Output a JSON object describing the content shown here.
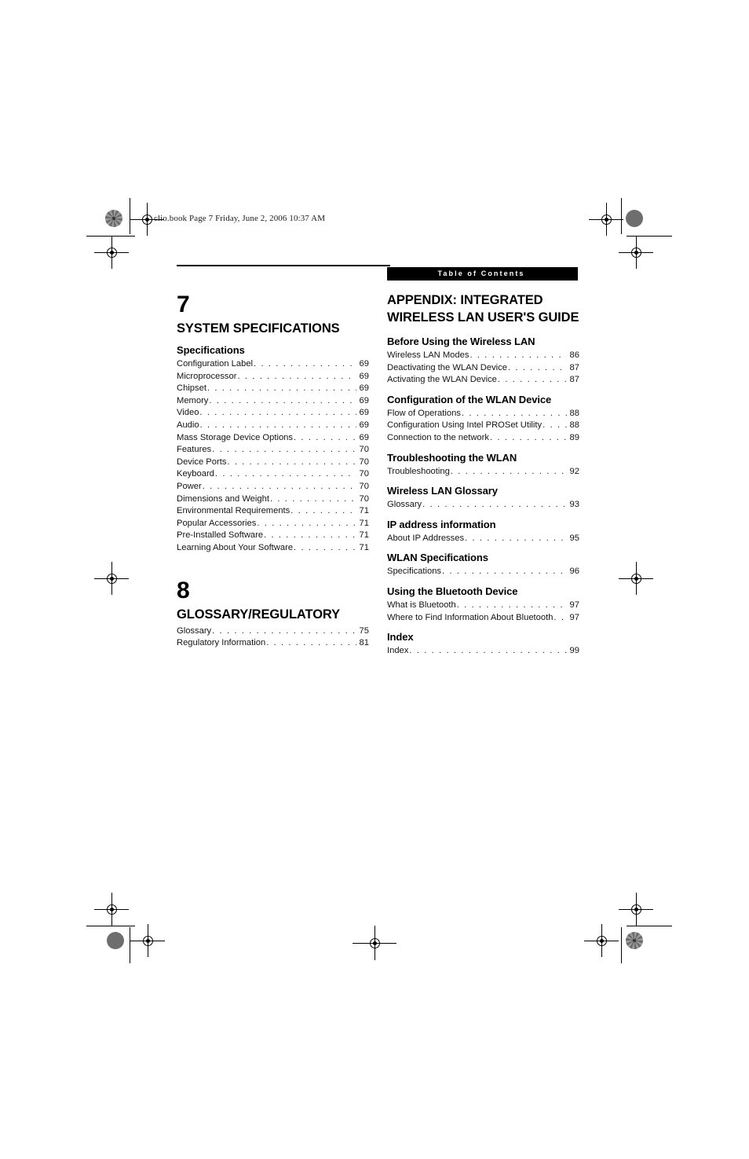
{
  "document_header": "clio.book  Page 7  Friday, June 2, 2006  10:37 AM",
  "banner": {
    "label": "Table of Contents"
  },
  "left_column": {
    "chapters": [
      {
        "number": "7",
        "title": "SYSTEM SPECIFICATIONS",
        "sections": [
          {
            "heading": "Specifications",
            "entries": [
              {
                "label": "Configuration Label",
                "page": "69"
              },
              {
                "label": "Microprocessor",
                "page": "69"
              },
              {
                "label": "Chipset",
                "page": "69"
              },
              {
                "label": "Memory",
                "page": "69"
              },
              {
                "label": "Video",
                "page": "69"
              },
              {
                "label": "Audio",
                "page": "69"
              },
              {
                "label": "Mass Storage Device Options",
                "page": "69"
              },
              {
                "label": "Features",
                "page": "70"
              },
              {
                "label": "Device Ports",
                "page": "70"
              },
              {
                "label": "Keyboard",
                "page": "70"
              },
              {
                "label": "Power",
                "page": "70"
              },
              {
                "label": "Dimensions and Weight",
                "page": "70"
              },
              {
                "label": "Environmental Requirements",
                "page": "71"
              },
              {
                "label": "Popular Accessories",
                "page": "71"
              },
              {
                "label": "Pre-Installed Software",
                "page": "71"
              },
              {
                "label": "Learning About Your Software",
                "page": "71"
              }
            ]
          }
        ]
      },
      {
        "number": "8",
        "title": "GLOSSARY/REGULATORY",
        "sections": [
          {
            "heading": "",
            "entries": [
              {
                "label": "Glossary",
                "page": "75"
              },
              {
                "label": "Regulatory Information",
                "page": "81"
              }
            ]
          }
        ]
      }
    ]
  },
  "right_column": {
    "title": "APPENDIX: INTEGRATED WIRELESS LAN USER'S GUIDE",
    "sections": [
      {
        "heading": "Before Using the Wireless LAN",
        "entries": [
          {
            "label": "Wireless LAN Modes",
            "page": "86"
          },
          {
            "label": "Deactivating the WLAN Device",
            "page": "87"
          },
          {
            "label": "Activating the WLAN Device",
            "page": "87"
          }
        ]
      },
      {
        "heading": "Configuration of the WLAN Device",
        "entries": [
          {
            "label": "Flow of Operations",
            "page": "88"
          },
          {
            "label": "Configuration Using Intel PROSet Utility",
            "page": "88"
          },
          {
            "label": "Connection to the network",
            "page": "89"
          }
        ]
      },
      {
        "heading": "Troubleshooting the WLAN",
        "entries": [
          {
            "label": "Troubleshooting",
            "page": "92"
          }
        ]
      },
      {
        "heading": "Wireless LAN Glossary",
        "entries": [
          {
            "label": "Glossary",
            "page": "93"
          }
        ]
      },
      {
        "heading": "IP address information",
        "entries": [
          {
            "label": "About IP Addresses",
            "page": "95"
          }
        ]
      },
      {
        "heading": "WLAN Specifications",
        "entries": [
          {
            "label": "Specifications",
            "page": "96"
          }
        ]
      },
      {
        "heading": "Using the Bluetooth Device",
        "entries": [
          {
            "label": "What is Bluetooth",
            "page": "97"
          },
          {
            "label": "Where to Find Information About Bluetooth",
            "page": "97"
          }
        ]
      },
      {
        "heading": "Index",
        "entries": [
          {
            "label": "Index",
            "page": "99"
          }
        ]
      }
    ]
  },
  "colors": {
    "banner_bg": "#000000",
    "banner_text": "#ffffff",
    "body_text": "#141414",
    "page_bg": "#ffffff",
    "registration_mark": "#6e6e6e"
  }
}
